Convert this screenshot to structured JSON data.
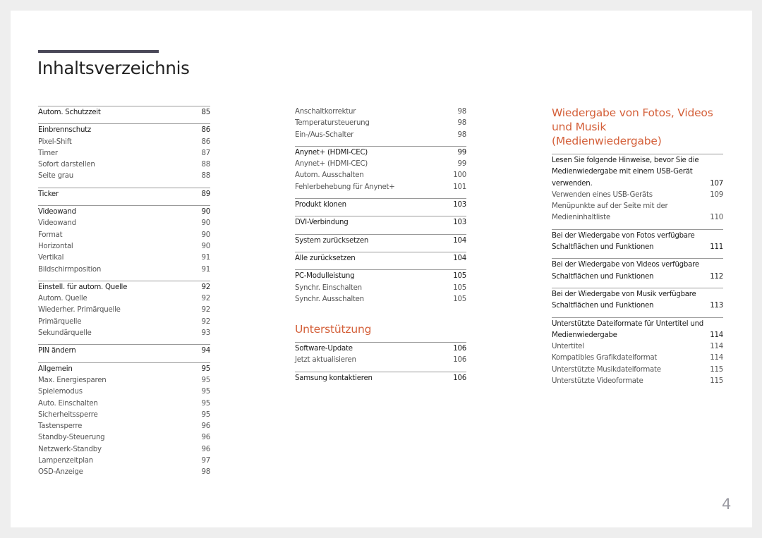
{
  "page_title": "Inhaltsverzeichnis",
  "page_number": "4",
  "accent_color": "#d4603a",
  "column1": [
    {
      "head": {
        "label": "Autom. Schutzzeit",
        "page": "85"
      },
      "items": []
    },
    {
      "head": {
        "label": "Einbrennschutz",
        "page": "86"
      },
      "items": [
        {
          "label": "Pixel-Shift",
          "page": "86"
        },
        {
          "label": "Timer",
          "page": "87"
        },
        {
          "label": "Sofort darstellen",
          "page": "88"
        },
        {
          "label": "Seite grau",
          "page": "88"
        }
      ]
    },
    {
      "head": {
        "label": "Ticker",
        "page": "89"
      },
      "items": []
    },
    {
      "head": {
        "label": "Videowand",
        "page": "90"
      },
      "items": [
        {
          "label": "Videowand",
          "page": "90"
        },
        {
          "label": "Format",
          "page": "90"
        },
        {
          "label": "Horizontal",
          "page": "90"
        },
        {
          "label": "Vertikal",
          "page": "91"
        },
        {
          "label": "Bildschirmposition",
          "page": "91"
        }
      ]
    },
    {
      "head": {
        "label": "Einstell. für autom. Quelle",
        "page": "92"
      },
      "items": [
        {
          "label": "Autom. Quelle",
          "page": "92"
        },
        {
          "label": "Wiederher. Primärquelle",
          "page": "92"
        },
        {
          "label": "Primärquelle",
          "page": "92"
        },
        {
          "label": "Sekundärquelle",
          "page": "93"
        }
      ]
    },
    {
      "head": {
        "label": "PIN ändern",
        "page": "94"
      },
      "items": []
    },
    {
      "head": {
        "label": "Allgemein",
        "page": "95"
      },
      "items": [
        {
          "label": "Max. Energiesparen",
          "page": "95"
        },
        {
          "label": "Spielemodus",
          "page": "95"
        },
        {
          "label": "Auto. Einschalten",
          "page": "95"
        },
        {
          "label": "Sicherheitssperre",
          "page": "95"
        },
        {
          "label": "Tastensperre",
          "page": "96"
        },
        {
          "label": "Standby-Steuerung",
          "page": "96"
        },
        {
          "label": "Netzwerk-Standby",
          "page": "96"
        },
        {
          "label": "Lampenzeitplan",
          "page": "97"
        },
        {
          "label": "OSD-Anzeige",
          "page": "98"
        }
      ]
    }
  ],
  "column2": {
    "continued": [
      {
        "label": "Anschaltkorrektur",
        "page": "98"
      },
      {
        "label": "Temperatursteuerung",
        "page": "98"
      },
      {
        "label": "Ein-/Aus-Schalter",
        "page": "98"
      }
    ],
    "sections": [
      {
        "head": {
          "label": "Anynet+ (HDMI-CEC)",
          "page": "99"
        },
        "items": [
          {
            "label": "Anynet+ (HDMI-CEC)",
            "page": "99"
          },
          {
            "label": "Autom. Ausschalten",
            "page": "100"
          },
          {
            "label": "Fehlerbehebung für Anynet+",
            "page": "101"
          }
        ]
      },
      {
        "head": {
          "label": "Produkt klonen",
          "page": "103"
        },
        "items": []
      },
      {
        "head": {
          "label": "DVI-Verbindung",
          "page": "103"
        },
        "items": []
      },
      {
        "head": {
          "label": "System zurücksetzen",
          "page": "104"
        },
        "items": []
      },
      {
        "head": {
          "label": "Alle zurücksetzen",
          "page": "104"
        },
        "items": []
      },
      {
        "head": {
          "label": "PC-Modulleistung",
          "page": "105"
        },
        "items": [
          {
            "label": "Synchr. Einschalten",
            "page": "105"
          },
          {
            "label": "Synchr. Ausschalten",
            "page": "105"
          }
        ]
      }
    ],
    "chapter_title": "Unterstützung",
    "chapter_sections": [
      {
        "head": {
          "label": "Software-Update",
          "page": "106"
        },
        "items": [
          {
            "label": "Jetzt aktualisieren",
            "page": "106"
          }
        ]
      },
      {
        "head": {
          "label": "Samsung kontaktieren",
          "page": "106"
        },
        "items": []
      }
    ]
  },
  "column3": {
    "chapter_title": "Wiedergabe von Fotos, Videos und Musik (Medienwiedergabe)",
    "sections": [
      {
        "head": {
          "label": "Lesen Sie folgende Hinweise, bevor Sie die\nMedienwiedergabe mit einem USB-Gerät\nverwenden.",
          "page": "107"
        },
        "items": [
          {
            "label": "Verwenden eines USB-Geräts",
            "page": "109"
          },
          {
            "label": "Menüpunkte auf der Seite mit der\nMedieninhaltliste",
            "page": "110"
          }
        ]
      },
      {
        "head": {
          "label": "Bei der Wiedergabe von Fotos verfügbare\nSchaltflächen und Funktionen",
          "page": "111"
        },
        "items": []
      },
      {
        "head": {
          "label": "Bei der Wiedergabe von Videos verfügbare\nSchaltflächen und Funktionen",
          "page": "112"
        },
        "items": []
      },
      {
        "head": {
          "label": "Bei der Wiedergabe von Musik verfügbare\nSchaltflächen und Funktionen",
          "page": "113"
        },
        "items": []
      },
      {
        "head": {
          "label": "Unterstützte Dateiformate für Untertitel und\nMedienwiedergabe",
          "page": "114"
        },
        "items": [
          {
            "label": "Untertitel",
            "page": "114"
          },
          {
            "label": "Kompatibles Grafikdateiformat",
            "page": "114"
          },
          {
            "label": "Unterstützte Musikdateiformate",
            "page": "115"
          },
          {
            "label": "Unterstützte Videoformate",
            "page": "115"
          }
        ]
      }
    ]
  }
}
